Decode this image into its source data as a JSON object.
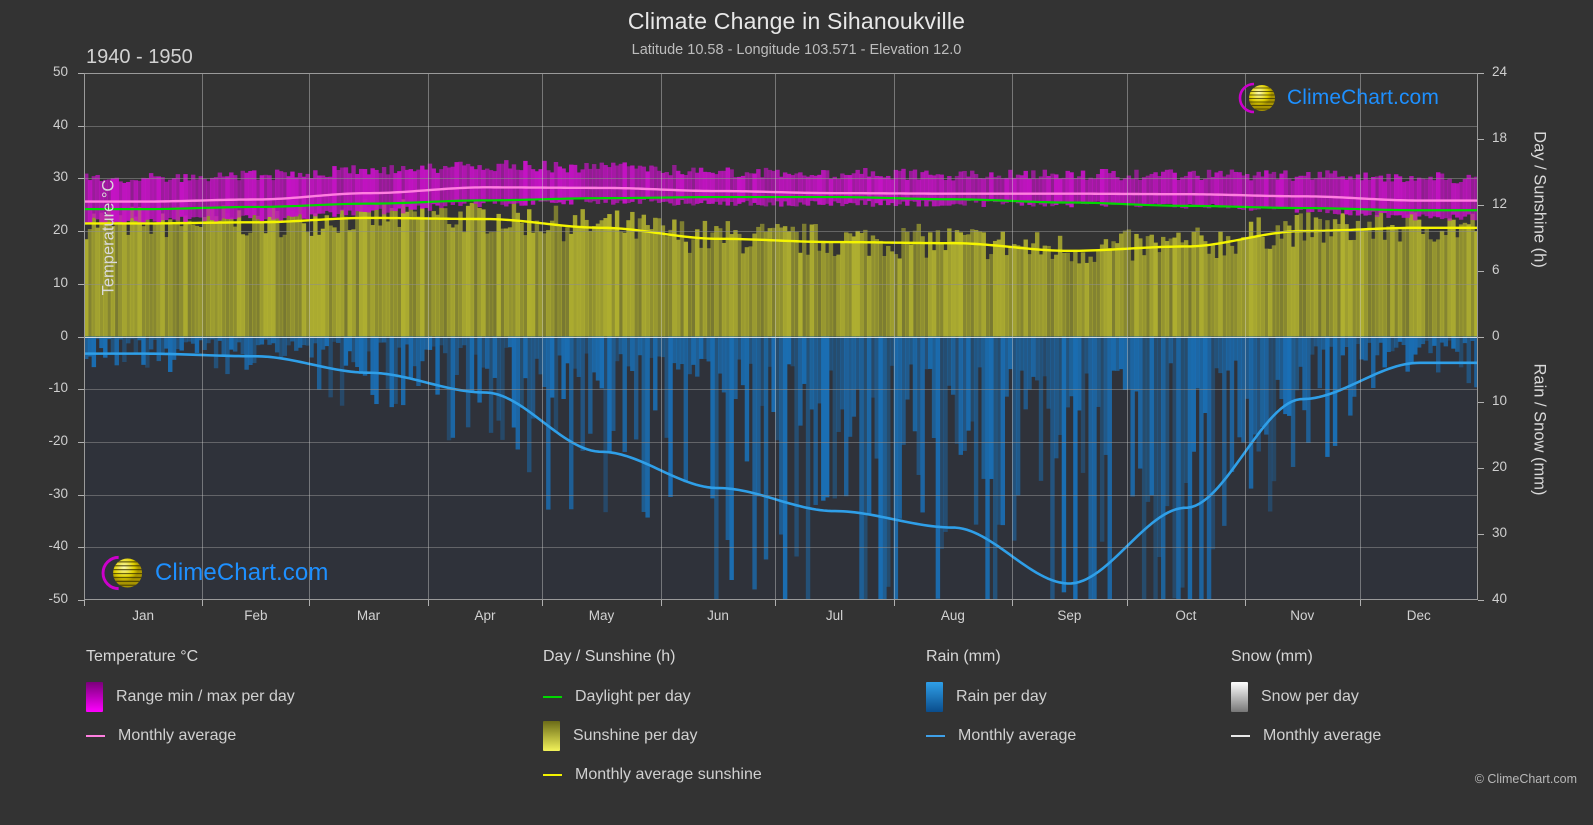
{
  "header": {
    "title": "Climate Change in Sihanoukville",
    "subtitle": "Latitude 10.58 - Longitude 103.571 - Elevation 12.0",
    "period": "1940 - 1950"
  },
  "branding": {
    "logo_text": "ClimeChart.com",
    "copyright": "© ClimeChart.com",
    "logo_icon": "climechart-sphere-logo"
  },
  "axes": {
    "left": {
      "label": "Temperature °C",
      "ticks": [
        "50",
        "40",
        "30",
        "20",
        "10",
        "0",
        "-10",
        "-20",
        "-30",
        "-40",
        "-50"
      ],
      "min": -50,
      "max": 50
    },
    "right_top": {
      "label": "Day / Sunshine (h)",
      "ticks": [
        "24",
        "18",
        "12",
        "6",
        "0"
      ],
      "min": 0,
      "max": 24
    },
    "right_bottom": {
      "label": "Rain / Snow (mm)",
      "ticks": [
        "0",
        "10",
        "20",
        "30",
        "40"
      ],
      "min": 0,
      "max": 40
    },
    "x": {
      "ticks": [
        "Jan",
        "Feb",
        "Mar",
        "Apr",
        "May",
        "Jun",
        "Jul",
        "Aug",
        "Sep",
        "Oct",
        "Nov",
        "Dec"
      ]
    }
  },
  "legend": {
    "temperature": {
      "heading": "Temperature °C",
      "items": [
        {
          "label": "Range min / max per day",
          "marker": "box",
          "color": "#d000d0"
        },
        {
          "label": "Monthly average",
          "marker": "line",
          "color": "#ff7fe0"
        }
      ]
    },
    "sunshine": {
      "heading": "Day / Sunshine (h)",
      "items": [
        {
          "label": "Daylight per day",
          "marker": "line",
          "color": "#00d800"
        },
        {
          "label": "Sunshine per day",
          "marker": "box",
          "color": "#d6d63c"
        },
        {
          "label": "Monthly average sunshine",
          "marker": "line",
          "color": "#f2f200"
        }
      ]
    },
    "rain": {
      "heading": "Rain (mm)",
      "items": [
        {
          "label": "Rain per day",
          "marker": "box",
          "color": "#1e84d8"
        },
        {
          "label": "Monthly average",
          "marker": "line",
          "color": "#3fa0e8"
        }
      ]
    },
    "snow": {
      "heading": "Snow (mm)",
      "items": [
        {
          "label": "Snow per day",
          "marker": "box",
          "color": "#e8e8e8"
        },
        {
          "label": "Monthly average",
          "marker": "line",
          "color": "#e8e8e8"
        }
      ]
    }
  },
  "colors": {
    "background": "#333333",
    "temp_range": "#c413c4",
    "temp_avg": "#ff7fe0",
    "daylight": "#00d800",
    "sunshine_fill": "#b0b030",
    "sunshine_avg": "#f5f500",
    "rain_fill": "#1a6fb5",
    "rain_avg": "#2f9fe8",
    "grid": "#9a9a9a"
  },
  "chart_data": {
    "type": "area",
    "title": "Climate Change in Sihanoukville",
    "subtitle": "Latitude 10.58 - Longitude 103.571 - Elevation 12.0",
    "period": "1940 - 1950",
    "xlabel": "",
    "ylabel": "Temperature °C",
    "ylim": [
      -50,
      50
    ],
    "grid": true,
    "legend_position": "below",
    "categories": [
      "Jan",
      "Feb",
      "Mar",
      "Apr",
      "May",
      "Jun",
      "Jul",
      "Aug",
      "Sep",
      "Oct",
      "Nov",
      "Dec"
    ],
    "series": [
      {
        "name": "Range min / max per day",
        "type": "band",
        "unit": "°C",
        "axis": "left",
        "min_values": [
          22.0,
          22.4,
          23.6,
          25.2,
          25.6,
          25.4,
          25.2,
          25.2,
          25.1,
          24.8,
          24.0,
          22.6
        ],
        "max_values": [
          30.0,
          30.4,
          31.4,
          32.3,
          32.0,
          31.2,
          30.8,
          30.6,
          30.6,
          30.6,
          30.4,
          30.0
        ]
      },
      {
        "name": "Monthly average (temperature)",
        "type": "line",
        "unit": "°C",
        "axis": "left",
        "color": "#ff7fe0",
        "values": [
          25.6,
          26.0,
          27.2,
          28.3,
          28.2,
          27.6,
          27.2,
          27.1,
          27.1,
          27.0,
          26.6,
          25.8
        ]
      },
      {
        "name": "Daylight per day",
        "type": "line",
        "unit": "h",
        "axis": "right_top",
        "color": "#00d800",
        "values": [
          11.6,
          11.8,
          12.1,
          12.4,
          12.6,
          12.7,
          12.7,
          12.5,
          12.2,
          11.9,
          11.7,
          11.5
        ]
      },
      {
        "name": "Sunshine per day",
        "type": "area",
        "unit": "h",
        "axis": "right_top",
        "color": "#b0b030",
        "values": [
          10.3,
          10.4,
          10.8,
          10.7,
          9.9,
          8.9,
          8.6,
          8.5,
          7.8,
          8.2,
          9.6,
          9.9
        ]
      },
      {
        "name": "Monthly average sunshine",
        "type": "line",
        "unit": "h",
        "axis": "right_top",
        "color": "#f5f500",
        "values": [
          10.3,
          10.4,
          10.8,
          10.7,
          9.9,
          8.9,
          8.6,
          8.5,
          7.8,
          8.2,
          9.6,
          9.9
        ]
      },
      {
        "name": "Rain per day",
        "type": "bars",
        "unit": "mm",
        "axis": "right_bottom",
        "color": "#1a6fb5",
        "values": [
          2.6,
          3.0,
          5.5,
          8.5,
          17.5,
          23.0,
          26.5,
          29.0,
          37.0,
          26.5,
          10.0,
          4.0
        ]
      },
      {
        "name": "Monthly average (rain)",
        "type": "line",
        "unit": "mm",
        "axis": "right_bottom",
        "color": "#2f9fe8",
        "values": [
          2.6,
          3.0,
          5.5,
          8.5,
          17.5,
          23.0,
          26.5,
          29.0,
          37.5,
          26.0,
          9.5,
          4.0
        ]
      },
      {
        "name": "Snow per day",
        "type": "bars",
        "unit": "mm",
        "axis": "right_bottom",
        "color": "#e8e8e8",
        "values": [
          0,
          0,
          0,
          0,
          0,
          0,
          0,
          0,
          0,
          0,
          0,
          0
        ]
      }
    ]
  }
}
